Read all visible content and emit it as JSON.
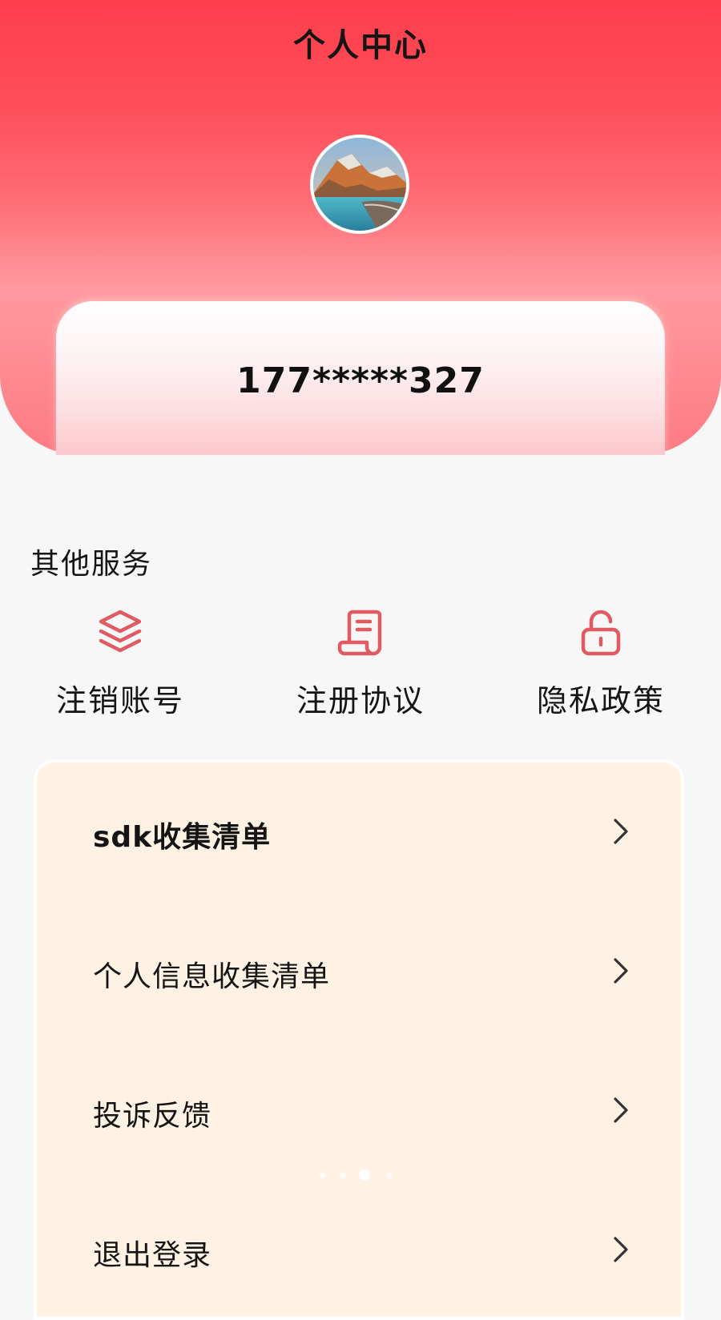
{
  "header": {
    "title": "个人中心"
  },
  "user": {
    "phone": "177*****327",
    "avatar_image": "mountain-lake-photo"
  },
  "services": {
    "title": "其他服务",
    "items": [
      {
        "label": "注销账号",
        "icon": "layers-icon"
      },
      {
        "label": "注册协议",
        "icon": "document-icon"
      },
      {
        "label": "隐私政策",
        "icon": "unlock-icon"
      }
    ]
  },
  "menu": {
    "items": [
      {
        "label": "sdk收集清单",
        "icon": "chevron-right-icon"
      },
      {
        "label": "个人信息收集清单",
        "icon": "chevron-right-icon"
      },
      {
        "label": "投诉反馈",
        "icon": "chevron-right-icon"
      },
      {
        "label": "退出登录",
        "icon": "chevron-right-icon"
      }
    ]
  },
  "pager": {
    "count": 4,
    "active_index": 2
  },
  "colors": {
    "header_red": "#fd3f4c",
    "icon_red": "#e05a62",
    "menu_bg": "#fef2e4",
    "page_bg": "#f7f7f8"
  }
}
